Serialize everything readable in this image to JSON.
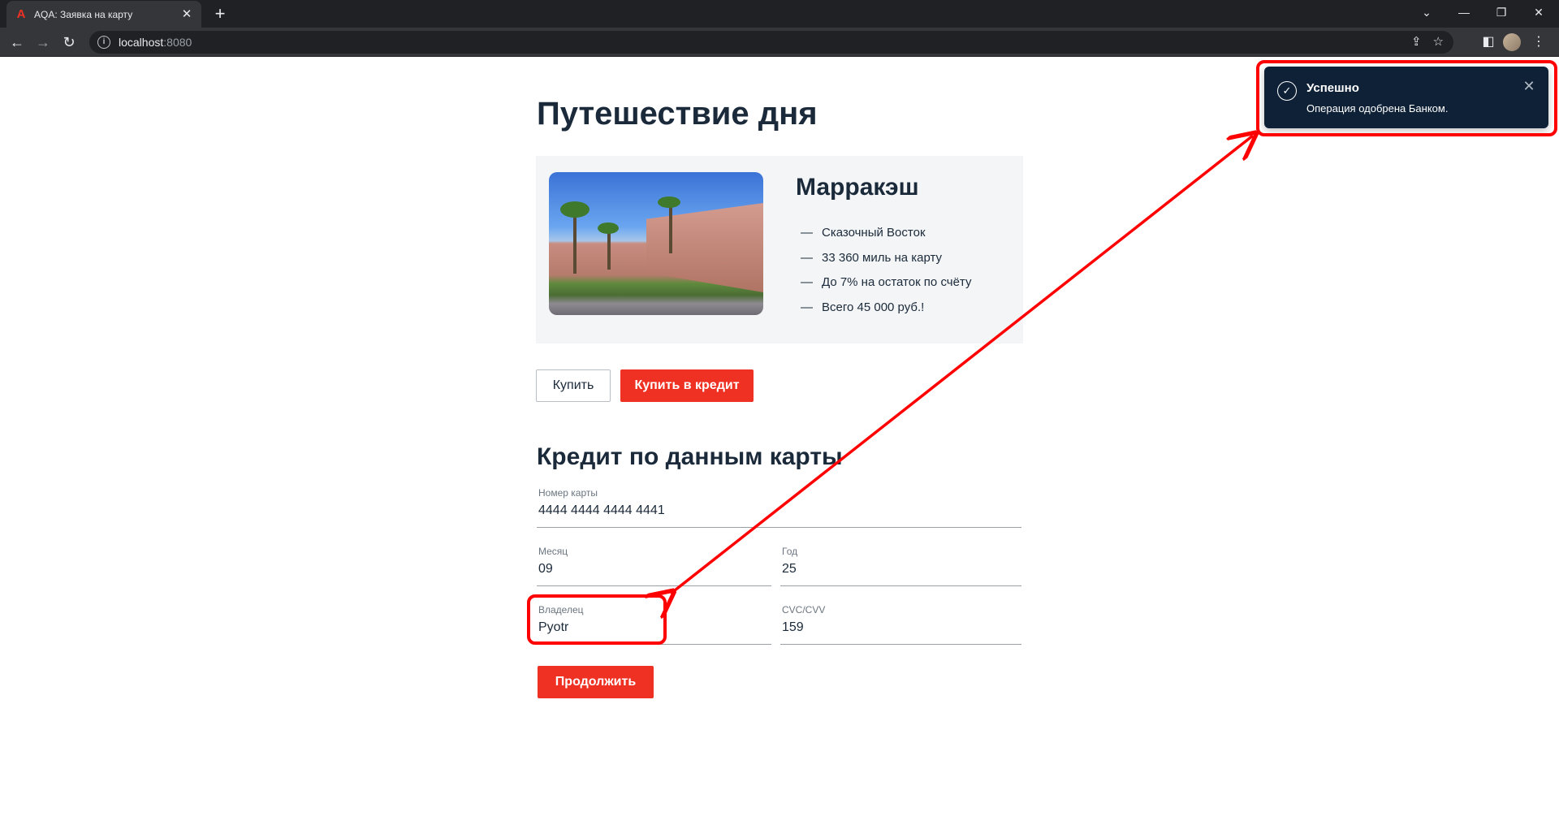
{
  "browser": {
    "tab_title": "AQA: Заявка на карту",
    "favicon": "А",
    "url_host": "localhost",
    "url_port": ":8080"
  },
  "page": {
    "title": "Путешествие дня",
    "offer": {
      "city": "Марракэш",
      "features": [
        "Сказочный Восток",
        "33 360 миль на карту",
        "До 7% на остаток по счёту",
        "Всего 45 000 руб.!"
      ],
      "dash": "—"
    },
    "buy_label": "Купить",
    "buy_credit_label": "Купить в кредит",
    "section_title": "Кредит по данным карты",
    "form": {
      "card_number": {
        "label": "Номер карты",
        "value": "4444 4444 4444 4441"
      },
      "month": {
        "label": "Месяц",
        "value": "09"
      },
      "year": {
        "label": "Год",
        "value": "25"
      },
      "owner": {
        "label": "Владелец",
        "value": "Pyotr"
      },
      "cvc": {
        "label": "CVC/CVV",
        "value": "159"
      },
      "submit_label": "Продолжить"
    }
  },
  "notification": {
    "title": "Успешно",
    "text": "Операция одобрена Банком.",
    "icon": "checkmark-circle-icon"
  },
  "colors": {
    "accent_red": "#ef3124",
    "toast_bg": "#0e2137",
    "annotation_red": "#ff0000"
  }
}
